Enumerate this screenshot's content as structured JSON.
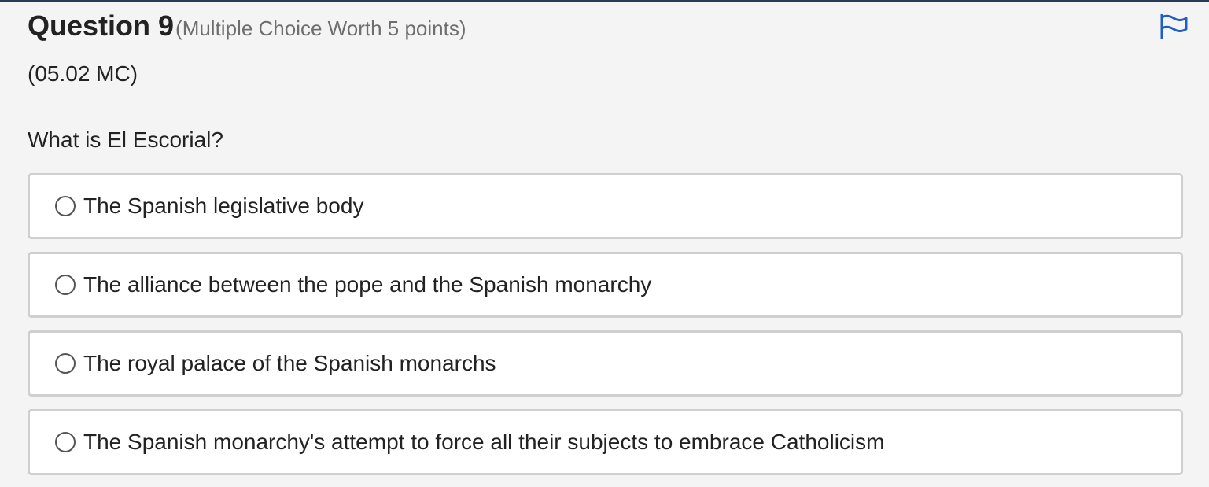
{
  "question": {
    "title": "Question 9",
    "meta": "(Multiple Choice Worth 5 points)",
    "code": "(05.02 MC)",
    "prompt": "What is El Escorial?",
    "flag_icon": "flag-icon",
    "accent_color": "#1f5fbf"
  },
  "options": [
    {
      "label": "The Spanish legislative body",
      "selected": false
    },
    {
      "label": "The alliance between the pope and the Spanish monarchy",
      "selected": false
    },
    {
      "label": "The royal palace of the Spanish monarchs",
      "selected": false
    },
    {
      "label": "The Spanish monarchy's attempt to force all their subjects to embrace Catholicism",
      "selected": false
    }
  ]
}
